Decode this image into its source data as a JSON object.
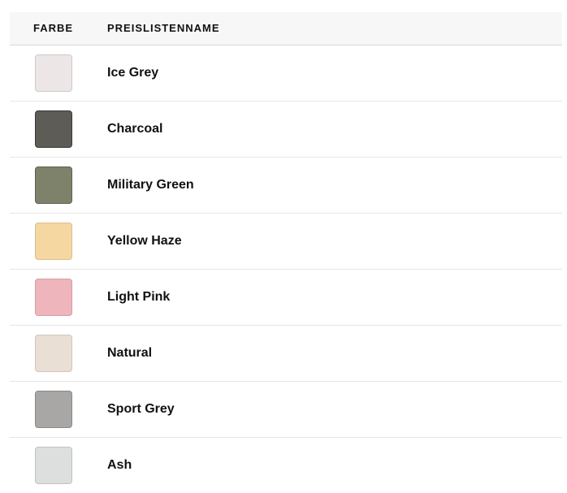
{
  "table": {
    "headers": {
      "color": "FARBE",
      "name": "PREISLISTENNAME"
    },
    "rows": [
      {
        "name": "Ice Grey",
        "color": "#ede6e6",
        "border": "#cfc9c9"
      },
      {
        "name": "Charcoal",
        "color": "#5d5c56",
        "border": "#3b3a36"
      },
      {
        "name": "Military Green",
        "color": "#7f826a",
        "border": "#5e604e"
      },
      {
        "name": "Yellow Haze",
        "color": "#f5d7a1",
        "border": "#dcbf8c"
      },
      {
        "name": "Light Pink",
        "color": "#efb5bc",
        "border": "#d59ca3"
      },
      {
        "name": "Natural",
        "color": "#e9dfd5",
        "border": "#cfc5bb"
      },
      {
        "name": "Sport Grey",
        "color": "#a8a7a5",
        "border": "#8a8987"
      },
      {
        "name": "Ash",
        "color": "#dcdfdd",
        "border": "#c0c3c1"
      }
    ]
  }
}
